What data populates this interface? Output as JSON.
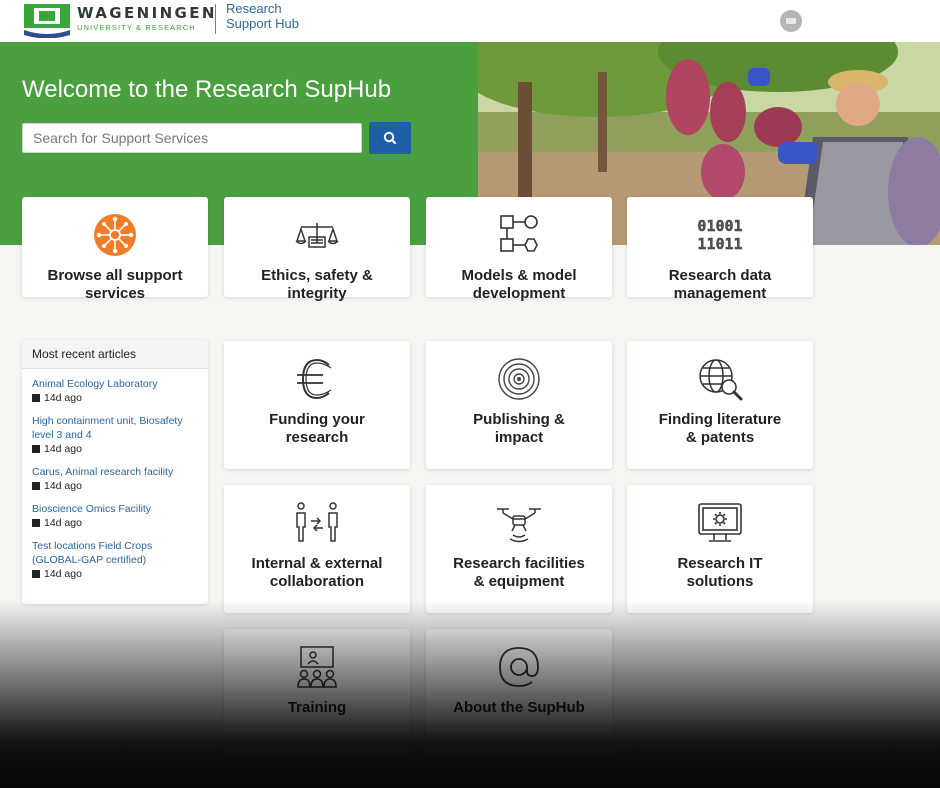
{
  "header": {
    "brand_name": "WAGENINGEN",
    "brand_sub": "UNIVERSITY & RESEARCH",
    "hub_line1": "Research",
    "hub_line2": "Support Hub"
  },
  "hero": {
    "title": "Welcome to the Research SupHub",
    "search_placeholder": "Search for Support Services",
    "accent_color": "#4aa03f",
    "button_color": "#1f5fa8"
  },
  "cards": [
    {
      "label_1": "Browse all support",
      "label_2": "services",
      "icon": "network-icon"
    },
    {
      "label_1": "Ethics, safety &",
      "label_2": "integrity",
      "icon": "scales-icon"
    },
    {
      "label_1": "Models & model",
      "label_2": "development",
      "icon": "model-diagram-icon"
    },
    {
      "label_1": "Research data",
      "label_2": "management",
      "icon": "binary-data-icon"
    },
    {
      "label_1": "Funding your",
      "label_2": "research",
      "icon": "euro-icon"
    },
    {
      "label_1": "Publishing &",
      "label_2": "impact",
      "icon": "target-icon"
    },
    {
      "label_1": "Finding literature",
      "label_2": "& patents",
      "icon": "globe-search-icon"
    },
    {
      "label_1": "Internal & external",
      "label_2": "collaboration",
      "icon": "collaboration-icon"
    },
    {
      "label_1": "Research facilities",
      "label_2": "& equipment",
      "icon": "drone-icon"
    },
    {
      "label_1": "Research IT",
      "label_2": "solutions",
      "icon": "monitor-gear-icon"
    },
    {
      "label_1": "Training",
      "label_2": "",
      "icon": "presentation-icon"
    },
    {
      "label_1": "About the SupHub",
      "label_2": "",
      "icon": "at-sign-icon"
    }
  ],
  "recent": {
    "title": "Most recent articles",
    "articles": [
      {
        "title_1": "Animal Ecology Laboratory",
        "title_2": "",
        "age": "14d ago"
      },
      {
        "title_1": "High containment unit, Biosafety",
        "title_2": "level 3 and 4",
        "age": "14d ago"
      },
      {
        "title_1": "Carus, Animal research facility",
        "title_2": "",
        "age": "14d ago"
      },
      {
        "title_1": "Bioscience Omics Facility",
        "title_2": "",
        "age": "14d ago"
      },
      {
        "title_1": "Test locations Field Crops",
        "title_2": "(GLOBAL-GAP certified)",
        "age": "14d ago"
      }
    ]
  }
}
